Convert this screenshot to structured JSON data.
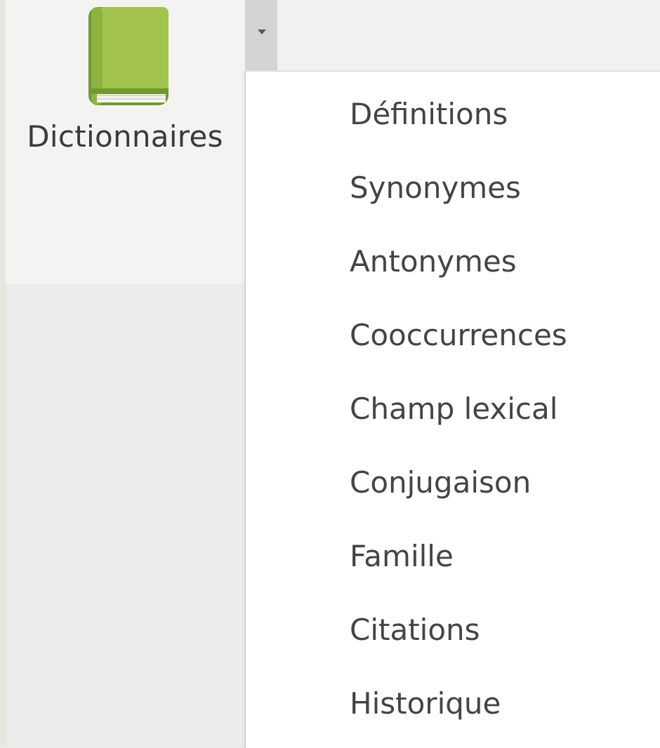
{
  "ribbon": {
    "group_label": "Dictionnaires",
    "icon": "book-icon",
    "dropdown_icon": "chevron-down-icon",
    "colors": {
      "book_green": "#a2c44d",
      "book_dark": "#6e9a2f",
      "ribbon_bg": "#f3f3f2",
      "dropdown_bg": "#d4d4d4"
    }
  },
  "menu": {
    "items": [
      {
        "label": "Définitions"
      },
      {
        "label": "Synonymes"
      },
      {
        "label": "Antonymes"
      },
      {
        "label": "Cooccurrences"
      },
      {
        "label": "Champ lexical"
      },
      {
        "label": "Conjugaison"
      },
      {
        "label": "Famille"
      },
      {
        "label": "Citations"
      },
      {
        "label": "Historique"
      }
    ]
  }
}
